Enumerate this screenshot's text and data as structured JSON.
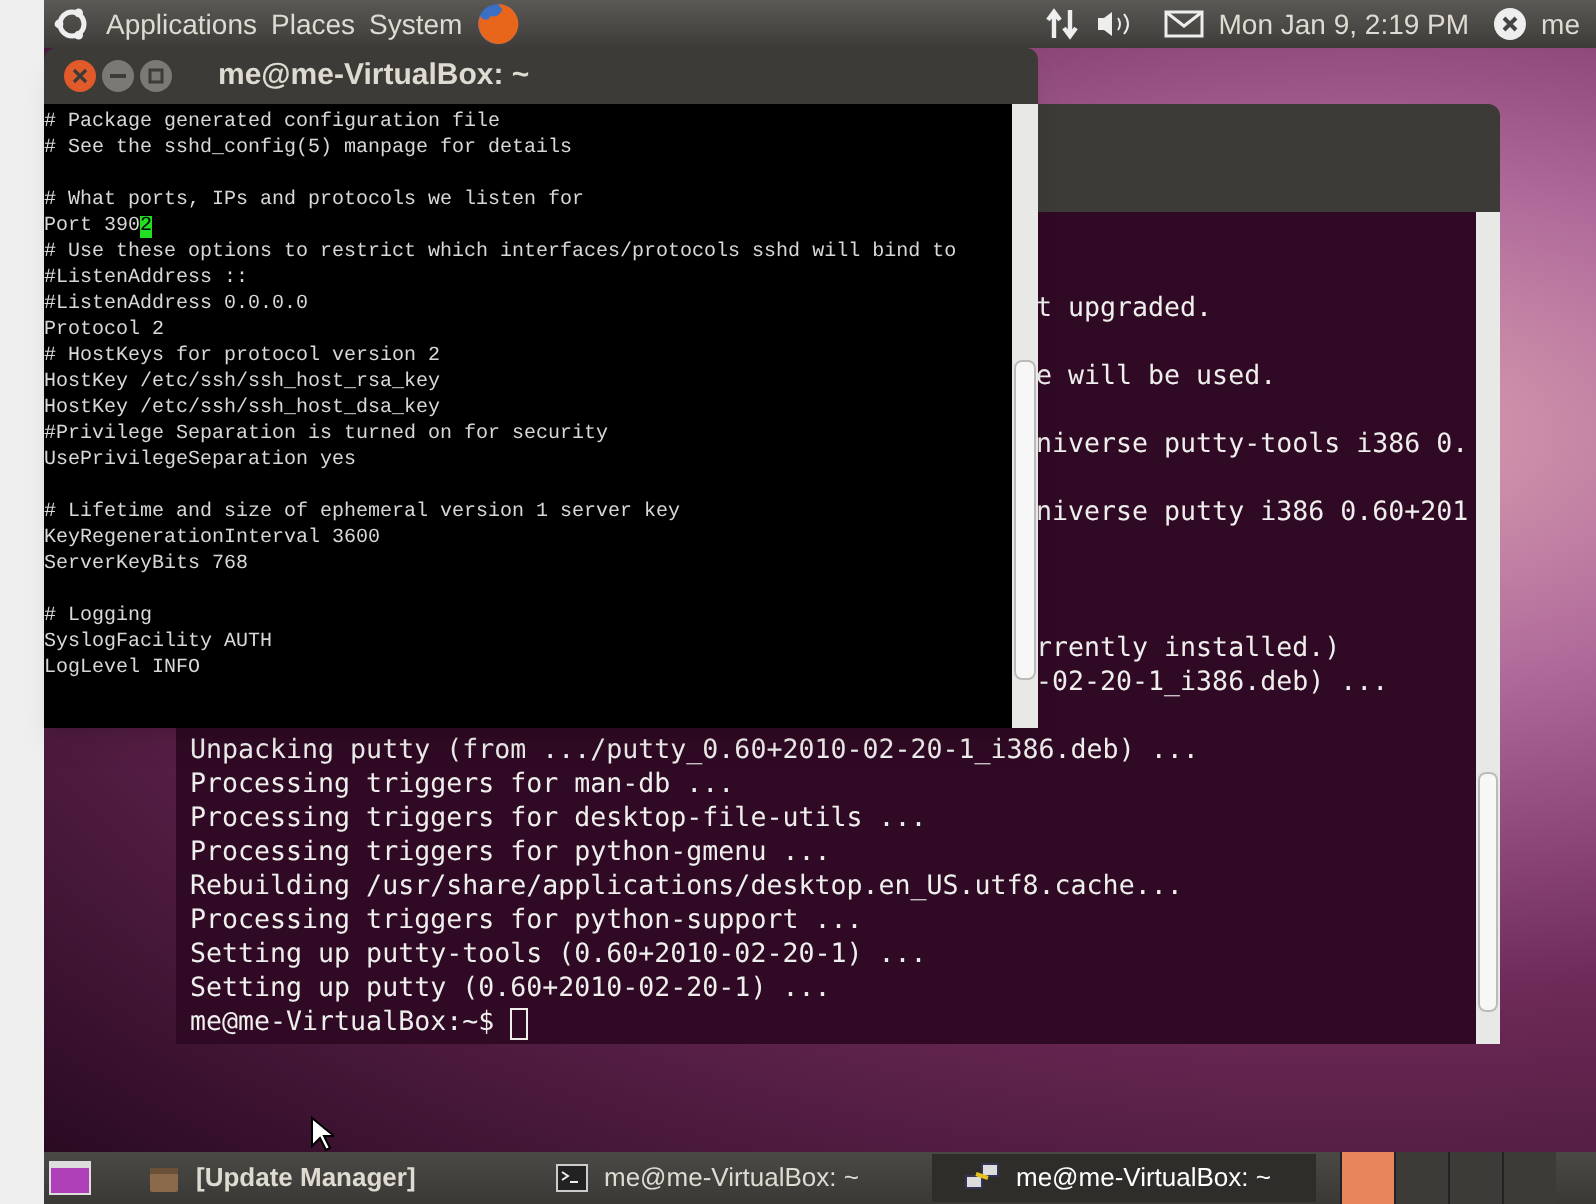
{
  "top_panel": {
    "menus": [
      "Applications",
      "Places",
      "System"
    ],
    "clock": "Mon Jan 9, 2:19 PM",
    "user": "me"
  },
  "putty_window": {
    "title": "me@me-VirtualBox: ~",
    "lines": [
      {
        "kind": "text",
        "text": "# Package generated configuration file"
      },
      {
        "kind": "text",
        "text": "# See the sshd_config(5) manpage for details"
      },
      {
        "kind": "blank"
      },
      {
        "kind": "text",
        "text": "# What ports, IPs and protocols we listen for"
      },
      {
        "kind": "text",
        "text": "Port 390",
        "cursor": "2"
      },
      {
        "kind": "text",
        "text": "# Use these options to restrict which interfaces/protocols sshd will bind to"
      },
      {
        "kind": "text",
        "text": "#ListenAddress ::"
      },
      {
        "kind": "text",
        "text": "#ListenAddress 0.0.0.0"
      },
      {
        "kind": "text",
        "text": "Protocol 2"
      },
      {
        "kind": "text",
        "text": "# HostKeys for protocol version 2"
      },
      {
        "kind": "text",
        "text": "HostKey /etc/ssh/ssh_host_rsa_key"
      },
      {
        "kind": "text",
        "text": "HostKey /etc/ssh/ssh_host_dsa_key"
      },
      {
        "kind": "text",
        "text": "#Privilege Separation is turned on for security"
      },
      {
        "kind": "text",
        "text": "UsePrivilegeSeparation yes"
      },
      {
        "kind": "blank"
      },
      {
        "kind": "text",
        "text": "# Lifetime and size of ephemeral version 1 server key"
      },
      {
        "kind": "text",
        "text": "KeyRegenerationInterval 3600"
      },
      {
        "kind": "text",
        "text": "ServerKeyBits 768"
      },
      {
        "kind": "blank"
      },
      {
        "kind": "text",
        "text": "# Logging"
      },
      {
        "kind": "text",
        "text": "SyslogFacility AUTH"
      },
      {
        "kind": "text",
        "text": "LogLevel INFO"
      }
    ]
  },
  "terminal_window": {
    "lines": [
      {
        "kind": "partial",
        "text": "t upgraded."
      },
      {
        "kind": "partial"
      },
      {
        "kind": "partial",
        "text": "e will be used."
      },
      {
        "kind": "partial"
      },
      {
        "kind": "partial",
        "text": "niverse putty-tools i386 0."
      },
      {
        "kind": "partial"
      },
      {
        "kind": "partial",
        "text": "niverse putty i386 0.60+201"
      },
      {
        "kind": "partial"
      },
      {
        "kind": "partial"
      },
      {
        "kind": "partial"
      },
      {
        "kind": "partial",
        "text": "rrently installed.)"
      },
      {
        "kind": "partial",
        "text": "-02-20-1_i386.deb) ..."
      },
      {
        "kind": "partial"
      },
      {
        "kind": "full",
        "text": "Unpacking putty (from .../putty_0.60+2010-02-20-1_i386.deb) ..."
      },
      {
        "kind": "full",
        "text": "Processing triggers for man-db ..."
      },
      {
        "kind": "full",
        "text": "Processing triggers for desktop-file-utils ..."
      },
      {
        "kind": "full",
        "text": "Processing triggers for python-gmenu ..."
      },
      {
        "kind": "full",
        "text": "Rebuilding /usr/share/applications/desktop.en_US.utf8.cache..."
      },
      {
        "kind": "full",
        "text": "Processing triggers for python-support ..."
      },
      {
        "kind": "full",
        "text": "Setting up putty-tools (0.60+2010-02-20-1) ..."
      },
      {
        "kind": "full",
        "text": "Setting up putty (0.60+2010-02-20-1) ..."
      },
      {
        "kind": "prompt",
        "text": "me@me-VirtualBox:~$"
      }
    ]
  },
  "taskbar": {
    "tasks": [
      {
        "kind": "package",
        "label": "[Update Manager]",
        "bold": true,
        "selected": false
      },
      {
        "kind": "terminal",
        "label": "me@me-VirtualBox: ~",
        "bold": false,
        "selected": false
      },
      {
        "kind": "putty",
        "label": "me@me-VirtualBox: ~",
        "bold": false,
        "selected": true
      }
    ],
    "workspaces": [
      {
        "selected": true
      },
      {
        "selected": false
      },
      {
        "selected": false
      },
      {
        "selected": false
      }
    ]
  }
}
